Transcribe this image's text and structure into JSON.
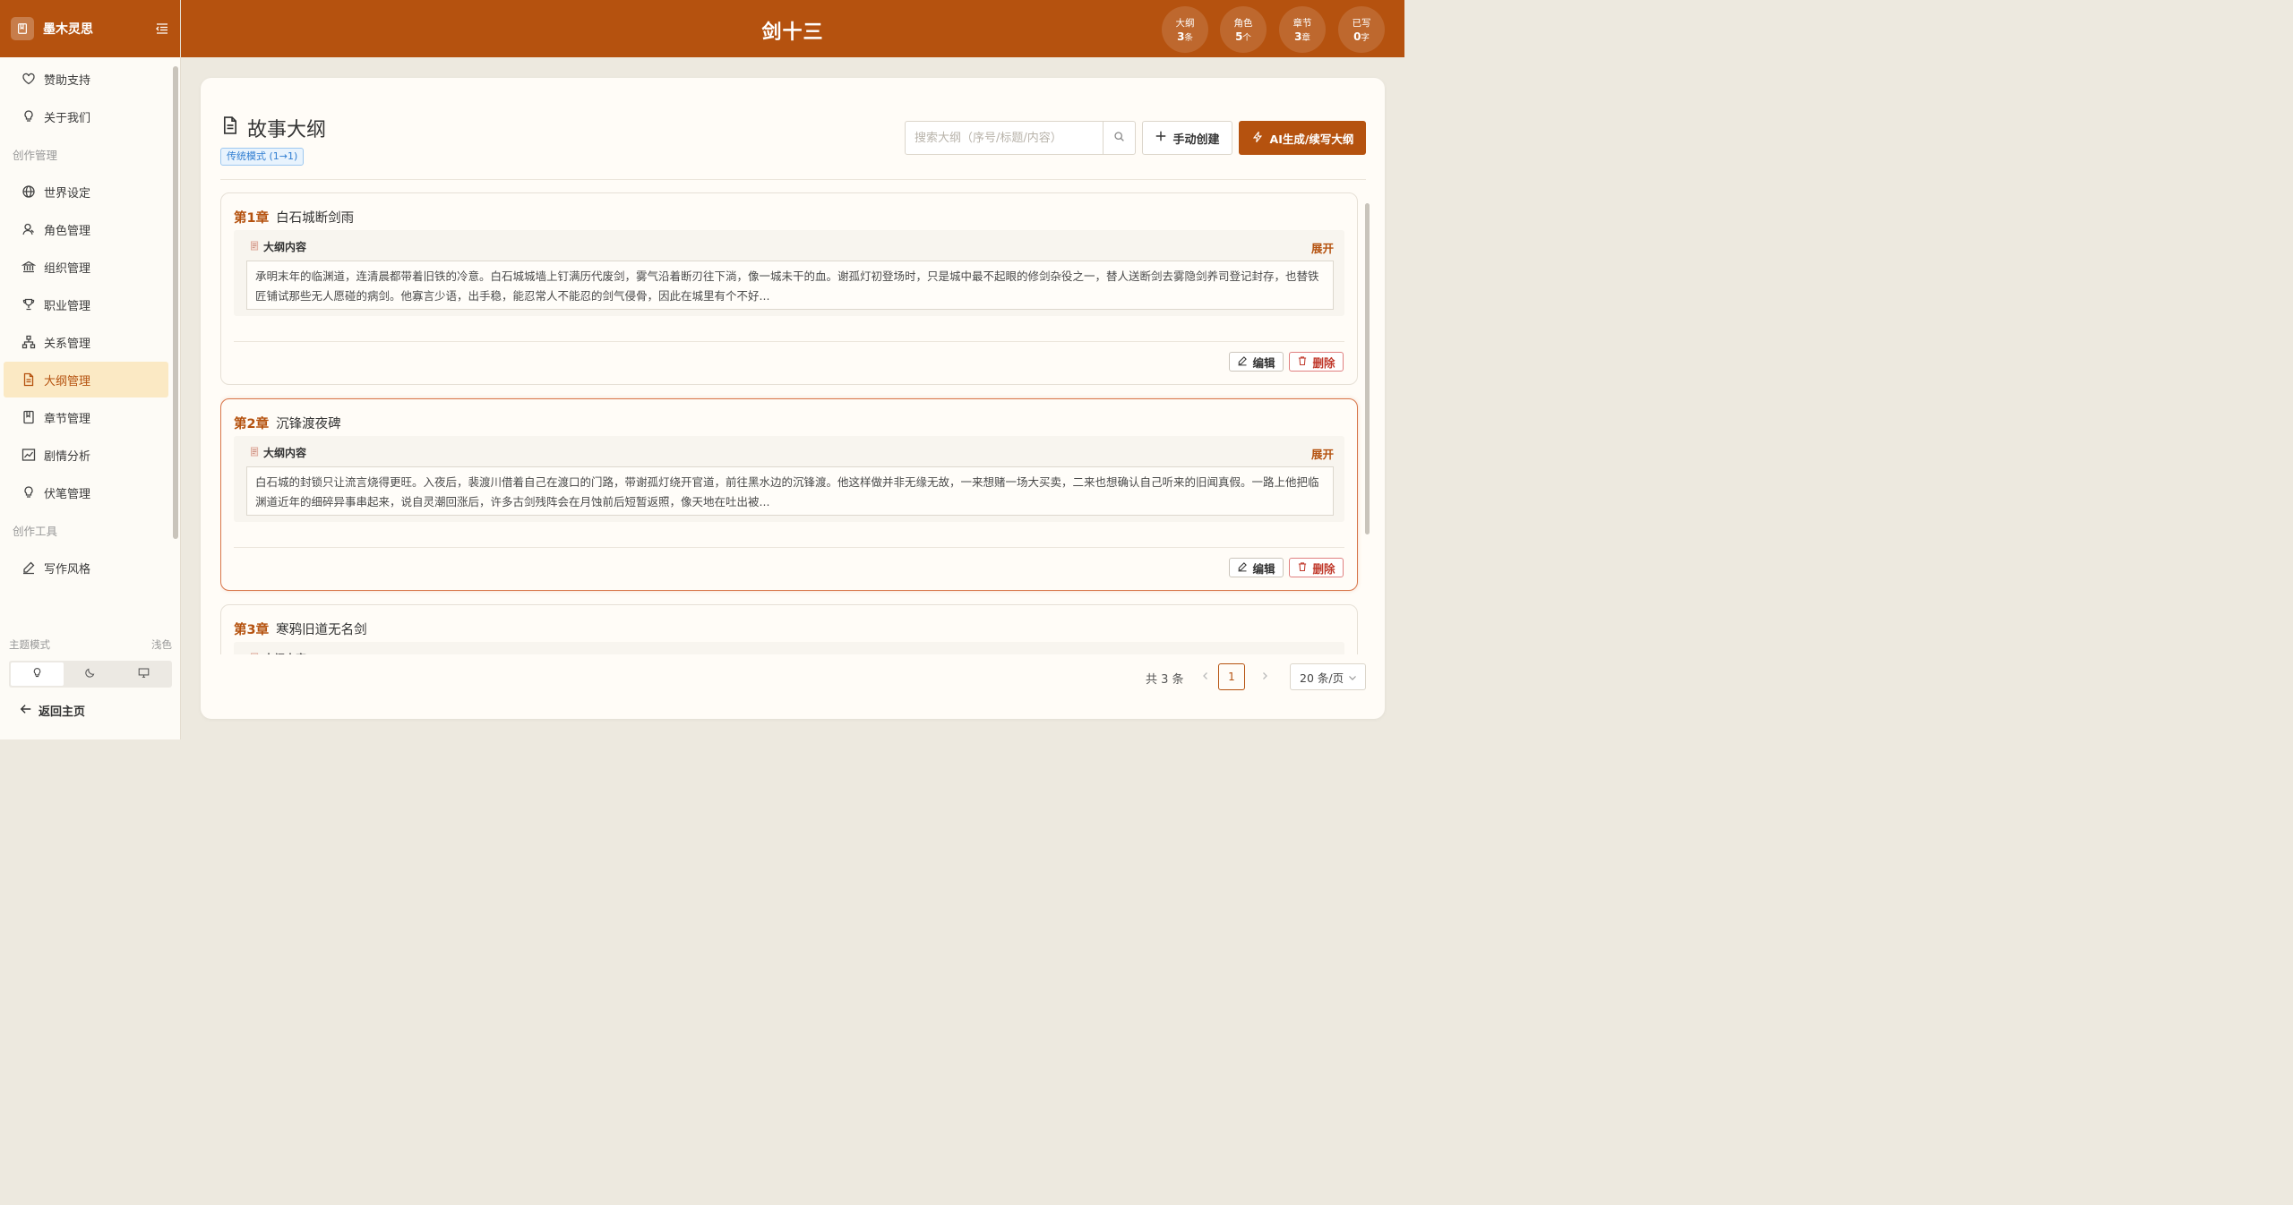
{
  "brand": {
    "name": "墨木灵思"
  },
  "header": {
    "title": "剑十三",
    "stats": [
      {
        "label": "大纲",
        "value": "3",
        "unit": "条"
      },
      {
        "label": "角色",
        "value": "5",
        "unit": "个"
      },
      {
        "label": "章节",
        "value": "3",
        "unit": "章"
      },
      {
        "label": "已写",
        "value": "0",
        "unit": "字"
      }
    ]
  },
  "sidebar": {
    "top_items": [
      {
        "label": "赞助支持",
        "icon": "heart-icon"
      },
      {
        "label": "关于我们",
        "icon": "bulb-icon"
      }
    ],
    "group1": "创作管理",
    "items": [
      {
        "label": "世界设定",
        "icon": "globe-icon"
      },
      {
        "label": "角色管理",
        "icon": "user-icon"
      },
      {
        "label": "组织管理",
        "icon": "bank-icon"
      },
      {
        "label": "职业管理",
        "icon": "trophy-icon"
      },
      {
        "label": "关系管理",
        "icon": "cluster-icon"
      },
      {
        "label": "大纲管理",
        "icon": "file-icon",
        "active": true
      },
      {
        "label": "章节管理",
        "icon": "book-icon"
      },
      {
        "label": "剧情分析",
        "icon": "chart-icon"
      },
      {
        "label": "伏笔管理",
        "icon": "bulb-icon"
      }
    ],
    "group2": "创作工具",
    "tools": [
      {
        "label": "写作风格",
        "icon": "edit-icon"
      }
    ],
    "theme_label": "主题模式",
    "theme_value": "浅色",
    "back_home": "返回主页"
  },
  "main": {
    "title": "故事大纲",
    "mode_tag": "传统模式 (1→1)",
    "search_placeholder": "搜索大纲（序号/标题/内容）",
    "create_label": "手动创建",
    "ai_label": "AI生成/续写大纲",
    "outline_label": "大纲内容",
    "expand_label": "展开",
    "edit_label": "编辑",
    "delete_label": "删除",
    "cards": [
      {
        "chapter": "第1章",
        "title": "白石城断剑雨",
        "content": "承明末年的临渊道，连清晨都带着旧铁的冷意。白石城城墙上钉满历代废剑，雾气沿着断刃往下淌，像一城未干的血。谢孤灯初登场时，只是城中最不起眼的修剑杂役之一，替人送断剑去雾隐剑养司登记封存，也替铁匠铺试那些无人愿碰的病剑。他寡言少语，出手稳，能忍常人不能忍的剑气侵骨，因此在城里有个不好..."
      },
      {
        "chapter": "第2章",
        "title": "沉锋渡夜碑",
        "content": "白石城的封锁只让流言烧得更旺。入夜后，裴渡川借着自己在渡口的门路，带谢孤灯绕开官道，前往黑水边的沉锋渡。他这样做并非无缘无故，一来想赌一场大买卖，二来也想确认自己听来的旧闻真假。一路上他把临渊道近年的细碎异事串起来，说自灵潮回涨后，许多古剑残阵会在月蚀前后短暂返照，像天地在吐出被..."
      },
      {
        "chapter": "第3章",
        "title": "寒鸦旧道无名剑",
        "content": ""
      }
    ],
    "pagination": {
      "total": "共 3 条",
      "current": "1",
      "page_size": "20 条/页"
    }
  },
  "colors": {
    "accent": "#b5520f",
    "active_bg": "#fbe9c4",
    "danger": "#c0392b",
    "tag_blue": "#2f7dd1"
  }
}
